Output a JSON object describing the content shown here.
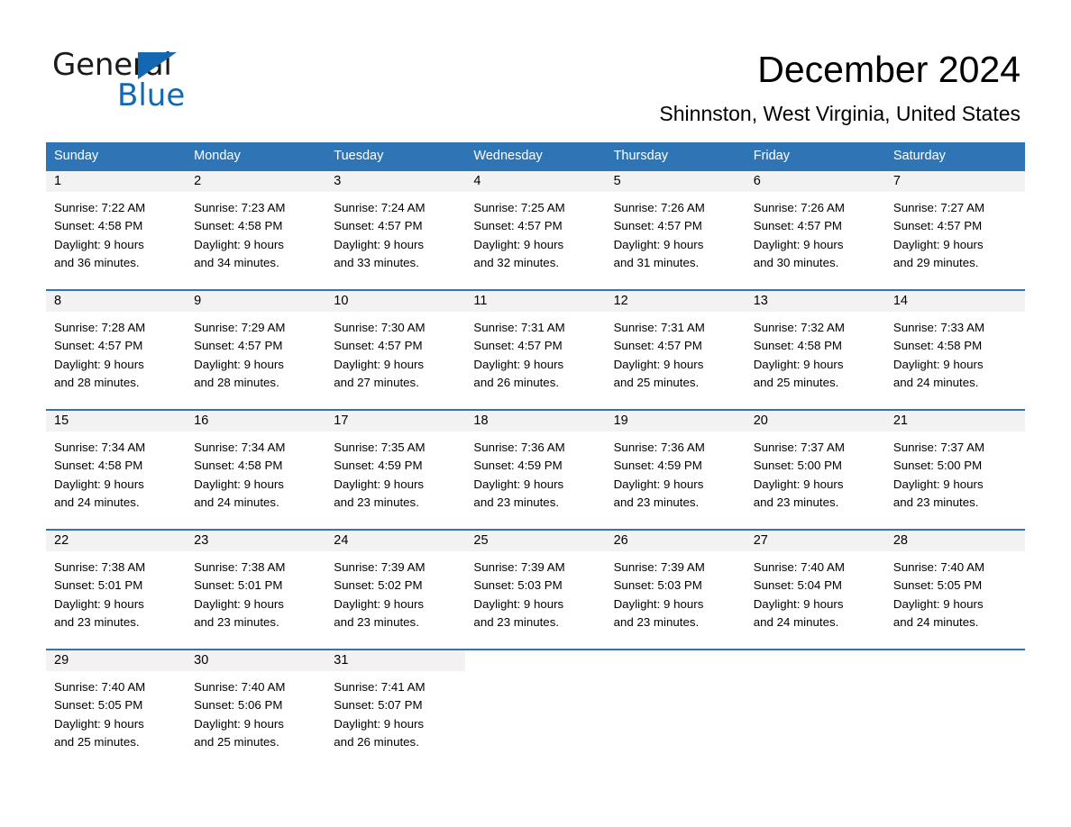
{
  "brand": {
    "word_one": "General",
    "word_two": "Blue",
    "accent_color": "#1268b3",
    "flag_icon": "triangle-flag-icon"
  },
  "header": {
    "title": "December 2024",
    "subtitle": "Shinnston, West Virginia, United States"
  },
  "theme": {
    "header_blue": "#2f75b5",
    "daynum_band": "#f2f2f2",
    "text": "#000000"
  },
  "calendar": {
    "weekdays": [
      "Sunday",
      "Monday",
      "Tuesday",
      "Wednesday",
      "Thursday",
      "Friday",
      "Saturday"
    ],
    "weeks": [
      [
        {
          "day": "1",
          "sunrise": "Sunrise: 7:22 AM",
          "sunset": "Sunset: 4:58 PM",
          "daylight_1": "Daylight: 9 hours",
          "daylight_2": "and 36 minutes."
        },
        {
          "day": "2",
          "sunrise": "Sunrise: 7:23 AM",
          "sunset": "Sunset: 4:58 PM",
          "daylight_1": "Daylight: 9 hours",
          "daylight_2": "and 34 minutes."
        },
        {
          "day": "3",
          "sunrise": "Sunrise: 7:24 AM",
          "sunset": "Sunset: 4:57 PM",
          "daylight_1": "Daylight: 9 hours",
          "daylight_2": "and 33 minutes."
        },
        {
          "day": "4",
          "sunrise": "Sunrise: 7:25 AM",
          "sunset": "Sunset: 4:57 PM",
          "daylight_1": "Daylight: 9 hours",
          "daylight_2": "and 32 minutes."
        },
        {
          "day": "5",
          "sunrise": "Sunrise: 7:26 AM",
          "sunset": "Sunset: 4:57 PM",
          "daylight_1": "Daylight: 9 hours",
          "daylight_2": "and 31 minutes."
        },
        {
          "day": "6",
          "sunrise": "Sunrise: 7:26 AM",
          "sunset": "Sunset: 4:57 PM",
          "daylight_1": "Daylight: 9 hours",
          "daylight_2": "and 30 minutes."
        },
        {
          "day": "7",
          "sunrise": "Sunrise: 7:27 AM",
          "sunset": "Sunset: 4:57 PM",
          "daylight_1": "Daylight: 9 hours",
          "daylight_2": "and 29 minutes."
        }
      ],
      [
        {
          "day": "8",
          "sunrise": "Sunrise: 7:28 AM",
          "sunset": "Sunset: 4:57 PM",
          "daylight_1": "Daylight: 9 hours",
          "daylight_2": "and 28 minutes."
        },
        {
          "day": "9",
          "sunrise": "Sunrise: 7:29 AM",
          "sunset": "Sunset: 4:57 PM",
          "daylight_1": "Daylight: 9 hours",
          "daylight_2": "and 28 minutes."
        },
        {
          "day": "10",
          "sunrise": "Sunrise: 7:30 AM",
          "sunset": "Sunset: 4:57 PM",
          "daylight_1": "Daylight: 9 hours",
          "daylight_2": "and 27 minutes."
        },
        {
          "day": "11",
          "sunrise": "Sunrise: 7:31 AM",
          "sunset": "Sunset: 4:57 PM",
          "daylight_1": "Daylight: 9 hours",
          "daylight_2": "and 26 minutes."
        },
        {
          "day": "12",
          "sunrise": "Sunrise: 7:31 AM",
          "sunset": "Sunset: 4:57 PM",
          "daylight_1": "Daylight: 9 hours",
          "daylight_2": "and 25 minutes."
        },
        {
          "day": "13",
          "sunrise": "Sunrise: 7:32 AM",
          "sunset": "Sunset: 4:58 PM",
          "daylight_1": "Daylight: 9 hours",
          "daylight_2": "and 25 minutes."
        },
        {
          "day": "14",
          "sunrise": "Sunrise: 7:33 AM",
          "sunset": "Sunset: 4:58 PM",
          "daylight_1": "Daylight: 9 hours",
          "daylight_2": "and 24 minutes."
        }
      ],
      [
        {
          "day": "15",
          "sunrise": "Sunrise: 7:34 AM",
          "sunset": "Sunset: 4:58 PM",
          "daylight_1": "Daylight: 9 hours",
          "daylight_2": "and 24 minutes."
        },
        {
          "day": "16",
          "sunrise": "Sunrise: 7:34 AM",
          "sunset": "Sunset: 4:58 PM",
          "daylight_1": "Daylight: 9 hours",
          "daylight_2": "and 24 minutes."
        },
        {
          "day": "17",
          "sunrise": "Sunrise: 7:35 AM",
          "sunset": "Sunset: 4:59 PM",
          "daylight_1": "Daylight: 9 hours",
          "daylight_2": "and 23 minutes."
        },
        {
          "day": "18",
          "sunrise": "Sunrise: 7:36 AM",
          "sunset": "Sunset: 4:59 PM",
          "daylight_1": "Daylight: 9 hours",
          "daylight_2": "and 23 minutes."
        },
        {
          "day": "19",
          "sunrise": "Sunrise: 7:36 AM",
          "sunset": "Sunset: 4:59 PM",
          "daylight_1": "Daylight: 9 hours",
          "daylight_2": "and 23 minutes."
        },
        {
          "day": "20",
          "sunrise": "Sunrise: 7:37 AM",
          "sunset": "Sunset: 5:00 PM",
          "daylight_1": "Daylight: 9 hours",
          "daylight_2": "and 23 minutes."
        },
        {
          "day": "21",
          "sunrise": "Sunrise: 7:37 AM",
          "sunset": "Sunset: 5:00 PM",
          "daylight_1": "Daylight: 9 hours",
          "daylight_2": "and 23 minutes."
        }
      ],
      [
        {
          "day": "22",
          "sunrise": "Sunrise: 7:38 AM",
          "sunset": "Sunset: 5:01 PM",
          "daylight_1": "Daylight: 9 hours",
          "daylight_2": "and 23 minutes."
        },
        {
          "day": "23",
          "sunrise": "Sunrise: 7:38 AM",
          "sunset": "Sunset: 5:01 PM",
          "daylight_1": "Daylight: 9 hours",
          "daylight_2": "and 23 minutes."
        },
        {
          "day": "24",
          "sunrise": "Sunrise: 7:39 AM",
          "sunset": "Sunset: 5:02 PM",
          "daylight_1": "Daylight: 9 hours",
          "daylight_2": "and 23 minutes."
        },
        {
          "day": "25",
          "sunrise": "Sunrise: 7:39 AM",
          "sunset": "Sunset: 5:03 PM",
          "daylight_1": "Daylight: 9 hours",
          "daylight_2": "and 23 minutes."
        },
        {
          "day": "26",
          "sunrise": "Sunrise: 7:39 AM",
          "sunset": "Sunset: 5:03 PM",
          "daylight_1": "Daylight: 9 hours",
          "daylight_2": "and 23 minutes."
        },
        {
          "day": "27",
          "sunrise": "Sunrise: 7:40 AM",
          "sunset": "Sunset: 5:04 PM",
          "daylight_1": "Daylight: 9 hours",
          "daylight_2": "and 24 minutes."
        },
        {
          "day": "28",
          "sunrise": "Sunrise: 7:40 AM",
          "sunset": "Sunset: 5:05 PM",
          "daylight_1": "Daylight: 9 hours",
          "daylight_2": "and 24 minutes."
        }
      ],
      [
        {
          "day": "29",
          "sunrise": "Sunrise: 7:40 AM",
          "sunset": "Sunset: 5:05 PM",
          "daylight_1": "Daylight: 9 hours",
          "daylight_2": "and 25 minutes."
        },
        {
          "day": "30",
          "sunrise": "Sunrise: 7:40 AM",
          "sunset": "Sunset: 5:06 PM",
          "daylight_1": "Daylight: 9 hours",
          "daylight_2": "and 25 minutes."
        },
        {
          "day": "31",
          "sunrise": "Sunrise: 7:41 AM",
          "sunset": "Sunset: 5:07 PM",
          "daylight_1": "Daylight: 9 hours",
          "daylight_2": "and 26 minutes."
        },
        {
          "day": "",
          "sunrise": "",
          "sunset": "",
          "daylight_1": "",
          "daylight_2": ""
        },
        {
          "day": "",
          "sunrise": "",
          "sunset": "",
          "daylight_1": "",
          "daylight_2": ""
        },
        {
          "day": "",
          "sunrise": "",
          "sunset": "",
          "daylight_1": "",
          "daylight_2": ""
        },
        {
          "day": "",
          "sunrise": "",
          "sunset": "",
          "daylight_1": "",
          "daylight_2": ""
        }
      ]
    ]
  }
}
